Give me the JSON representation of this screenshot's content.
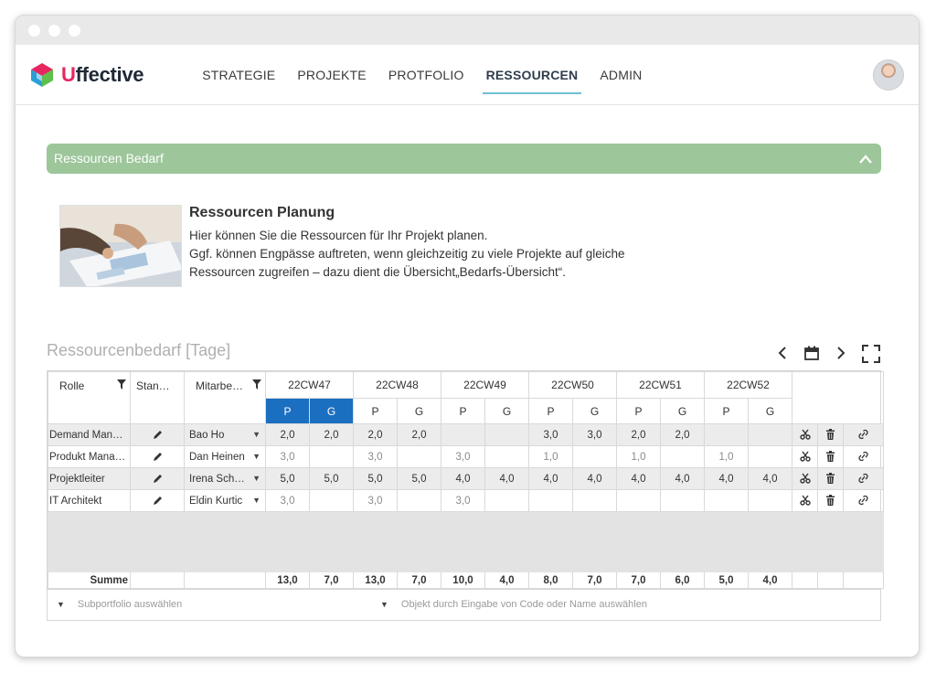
{
  "app": {
    "logo_u": "U",
    "logo_rest": "ffective",
    "nav": [
      {
        "label": "STRATEGIE"
      },
      {
        "label": "PROJEKTE"
      },
      {
        "label": "PROTFOLIO"
      },
      {
        "label": "RESSOURCEN"
      },
      {
        "label": "ADMIN"
      }
    ],
    "active_nav": "RESSOURCEN"
  },
  "section": {
    "title": "Ressourcen Bedarf"
  },
  "intro": {
    "title": "Ressourcen Planung",
    "lines": [
      "Hier können Sie die Ressourcen für Ihr Projekt planen.",
      "Ggf. können Engpässe auftreten, wenn gleichzeitig zu viele Projekte auf gleiche",
      "Ressourcen zugreifen – dazu dient die Übersicht„Bedarfs-Übersicht“."
    ]
  },
  "grid": {
    "title": "Ressourcenbedarf [Tage]",
    "col_rolle": "Rolle",
    "col_stand": "Stan…",
    "col_mitarbeiter": "Mitarbe…",
    "weeks": [
      "22CW47",
      "22CW48",
      "22CW49",
      "22CW50",
      "22CW51",
      "22CW52"
    ],
    "p_label": "P",
    "g_label": "G",
    "rows": [
      {
        "role": "Demand Man…",
        "employee": "Bao Ho",
        "cells": [
          "2,0",
          "2,0",
          "2,0",
          "2,0",
          "",
          "",
          "3,0",
          "3,0",
          "2,0",
          "2,0",
          "",
          ""
        ]
      },
      {
        "role": "Produkt Mana…",
        "employee": "Dan Heinen",
        "cells": [
          "3,0",
          "",
          "3,0",
          "",
          "3,0",
          "",
          "1,0",
          "",
          "1,0",
          "",
          "1,0",
          ""
        ]
      },
      {
        "role": "Projektleiter",
        "employee": "Irena Sch…",
        "cells": [
          "5,0",
          "5,0",
          "5,0",
          "5,0",
          "4,0",
          "4,0",
          "4,0",
          "4,0",
          "4,0",
          "4,0",
          "4,0",
          "4,0"
        ]
      },
      {
        "role": "IT Architekt",
        "employee": "Eldin Kurtic",
        "cells": [
          "3,0",
          "",
          "3,0",
          "",
          "3,0",
          "",
          "",
          "",
          "",
          "",
          "",
          ""
        ]
      }
    ],
    "sum_label": "Summe",
    "sums": [
      "13,0",
      "7,0",
      "13,0",
      "7,0",
      "10,0",
      "4,0",
      "8,0",
      "7,0",
      "7,0",
      "6,0",
      "5,0",
      "4,0"
    ],
    "filter_subportfolio": "Subportfolio auswählen",
    "filter_object": "Objekt durch Eingabe von Code oder Name auswählen"
  },
  "colors": {
    "section_bar": "#9dc69b",
    "active_pg": "#1b6fc0",
    "nav_underline": "#6cc0d6",
    "logo_accent": "#e5265f"
  }
}
